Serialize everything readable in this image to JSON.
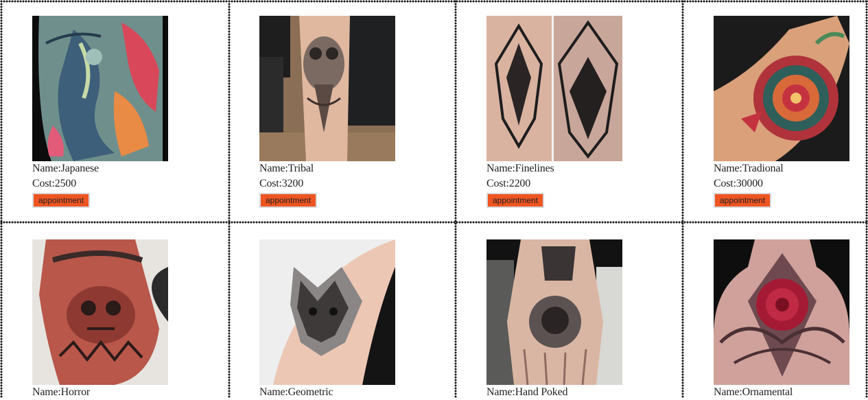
{
  "labels": {
    "name_prefix": "Name:",
    "cost_prefix": "Cost:"
  },
  "tattoos": [
    {
      "name": "Japanese",
      "cost": "2500",
      "button": "appointment",
      "image": "japanese-back-tattoo-image"
    },
    {
      "name": "Tribal",
      "cost": "3200",
      "button": "appointment",
      "image": "owl-leg-tattoo-image"
    },
    {
      "name": "Finelines",
      "cost": "2200",
      "button": "appointment",
      "image": "geometric-lion-tattoo-image"
    },
    {
      "name": "Tradional",
      "cost": "30000",
      "button": "appointment",
      "image": "mandala-elbow-tattoo-image"
    },
    {
      "name": "Horror",
      "cost": "",
      "button": "",
      "image": "skull-hand-tattoo-image"
    },
    {
      "name": "Geometric",
      "cost": "",
      "button": "",
      "image": "wolf-arm-tattoo-image"
    },
    {
      "name": "Hand Poked",
      "cost": "",
      "button": "",
      "image": "hand-poked-tattoo-image"
    },
    {
      "name": "Ornamental",
      "cost": "",
      "button": "",
      "image": "ornamental-back-tattoo-image"
    }
  ],
  "colors": {
    "button_bg": "#ee5522",
    "grid_dots": "#1a1a1a"
  }
}
